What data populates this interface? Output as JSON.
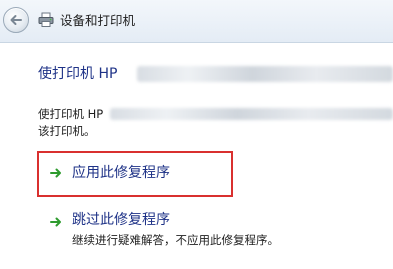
{
  "window": {
    "title": "设备和打印机"
  },
  "heading": {
    "prefix": "使打印机 HP"
  },
  "description": {
    "line1_prefix": "使打印机 HP",
    "line2": "该打印机。"
  },
  "options": [
    {
      "label": "应用此修复程序",
      "icon": "green-arrow-icon",
      "highlighted": true
    },
    {
      "label": "跳过此修复程序",
      "subtext": "继续进行疑难解答，不应用此修复程序。",
      "icon": "green-arrow-icon"
    }
  ],
  "colors": {
    "link": "#1e3287",
    "arrow": "#2e9b2e",
    "highlight": "#d9302f",
    "topbar": "#e4ecf5"
  }
}
